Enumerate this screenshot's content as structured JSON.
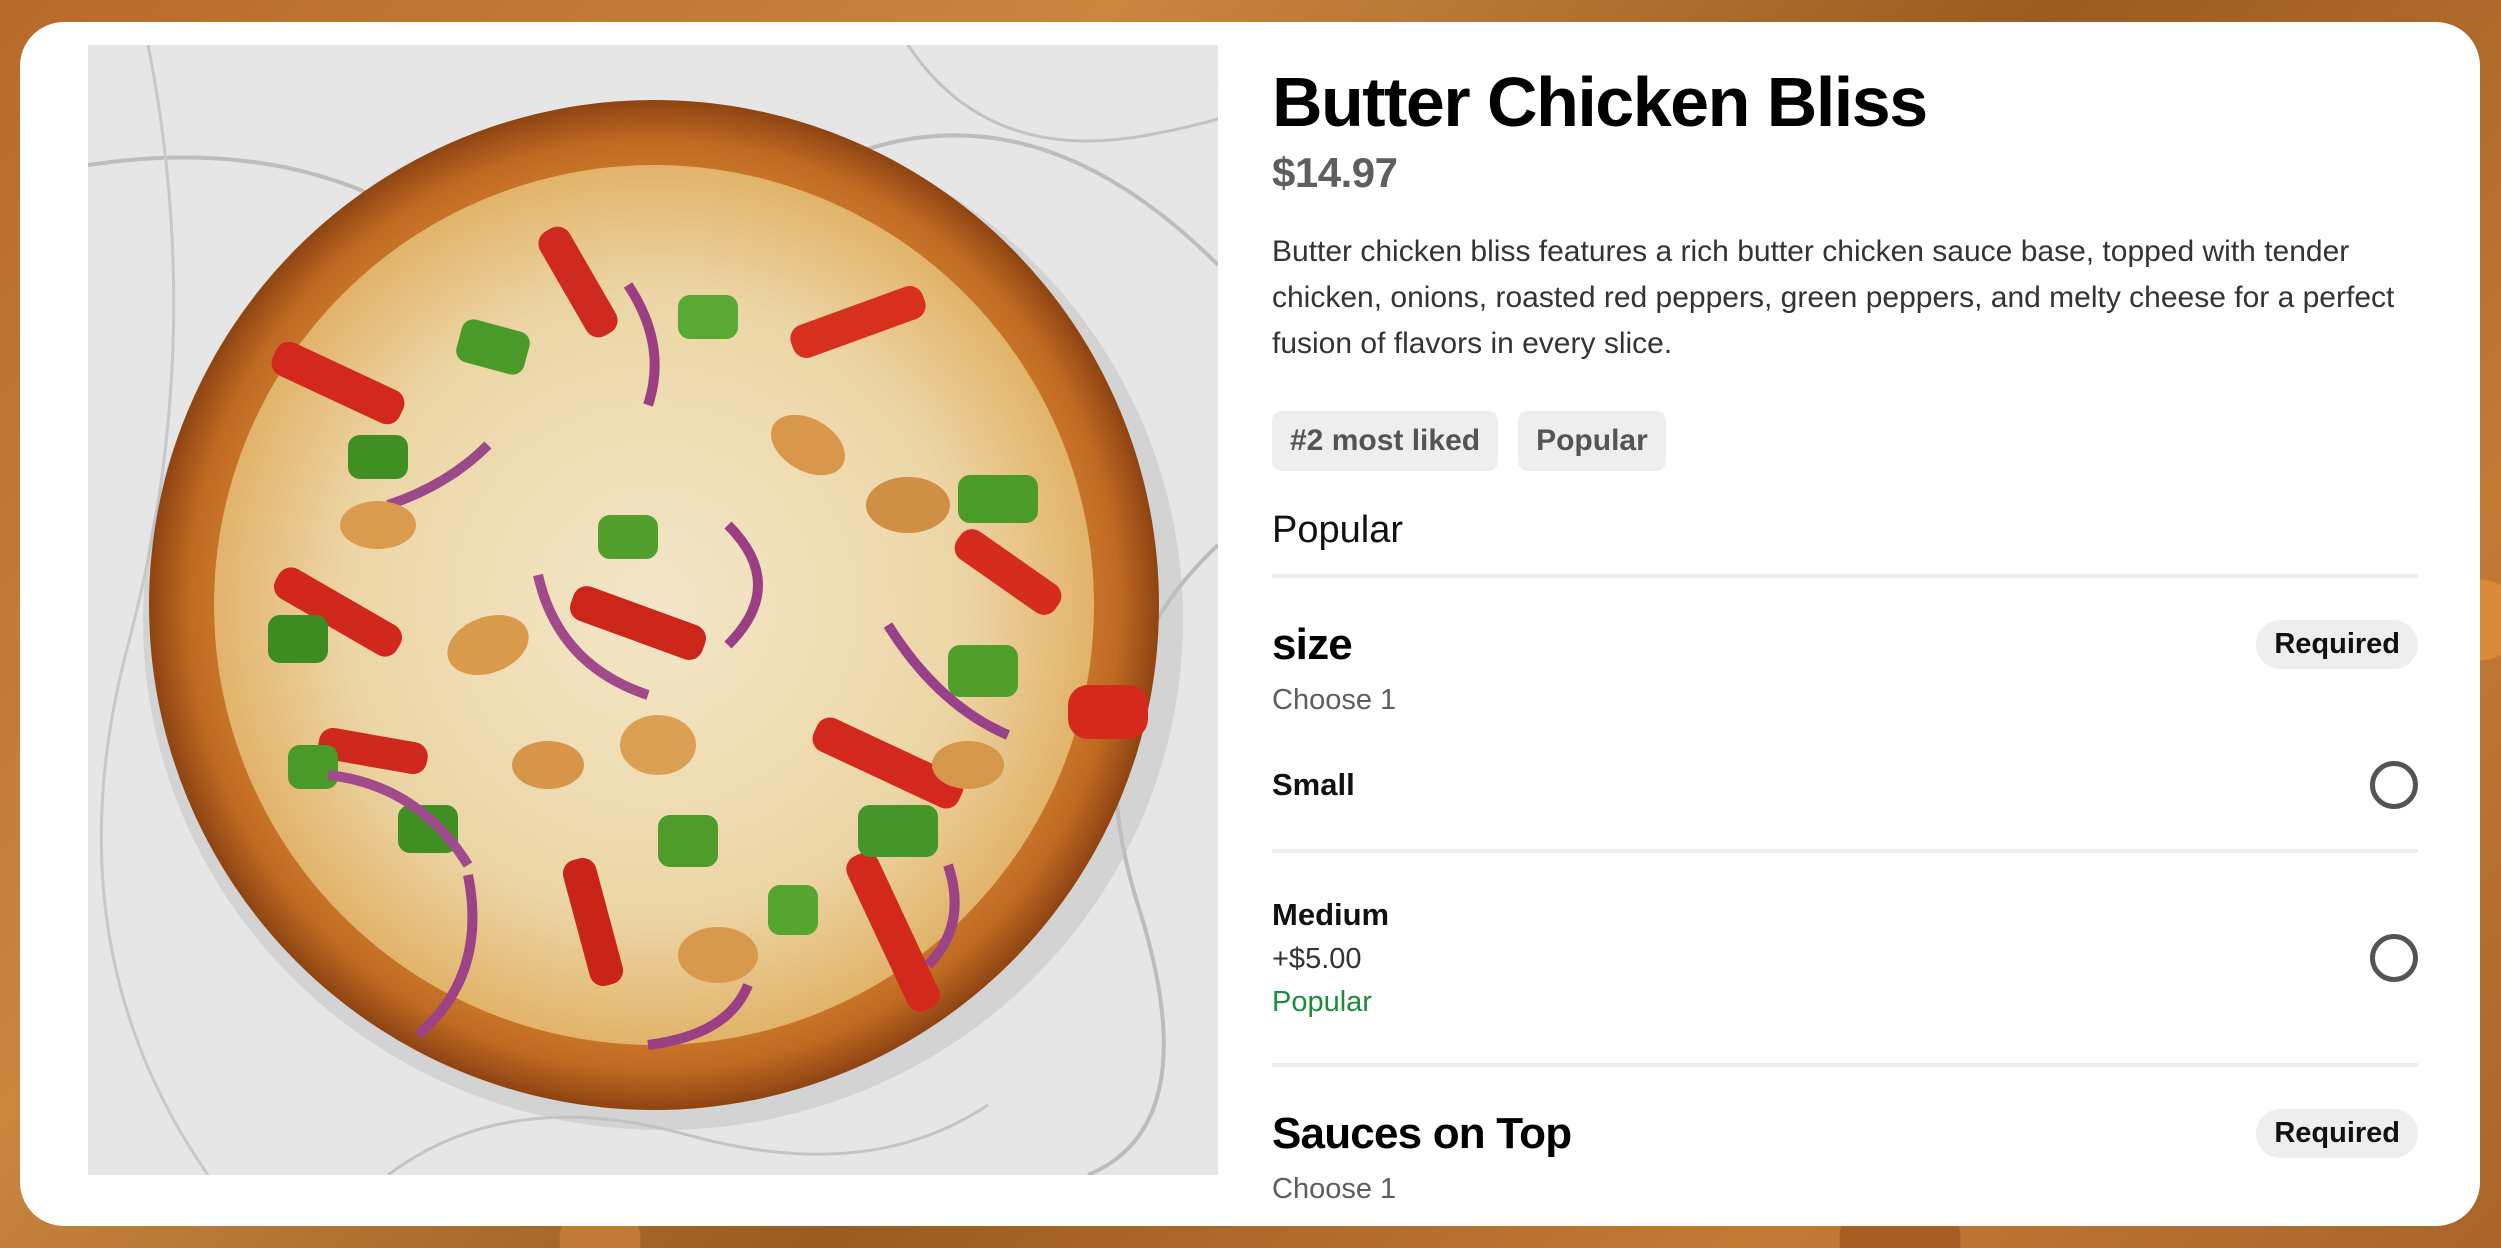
{
  "item": {
    "title": "Butter Chicken Bliss",
    "price": "$14.97",
    "description": "Butter chicken bliss features a rich butter chicken sauce base, topped with tender chicken, onions, roasted red peppers, green peppers, and melty cheese for a perfect fusion of flavors in every slice.",
    "tags": [
      "#2 most liked",
      "Popular"
    ],
    "image_icon": "pizza-photo"
  },
  "section_heading": "Popular",
  "groups": [
    {
      "title": "size",
      "badge": "Required",
      "subtitle": "Choose 1",
      "options": [
        {
          "name": "Small",
          "extra": "",
          "note": ""
        },
        {
          "name": "Medium",
          "extra": "+$5.00",
          "note": "Popular"
        }
      ]
    },
    {
      "title": "Sauces on Top",
      "badge": "Required",
      "subtitle": "Choose 1",
      "options": []
    }
  ],
  "colors": {
    "popular_green": "#1f8a3c",
    "badge_bg": "#eeeeee"
  }
}
